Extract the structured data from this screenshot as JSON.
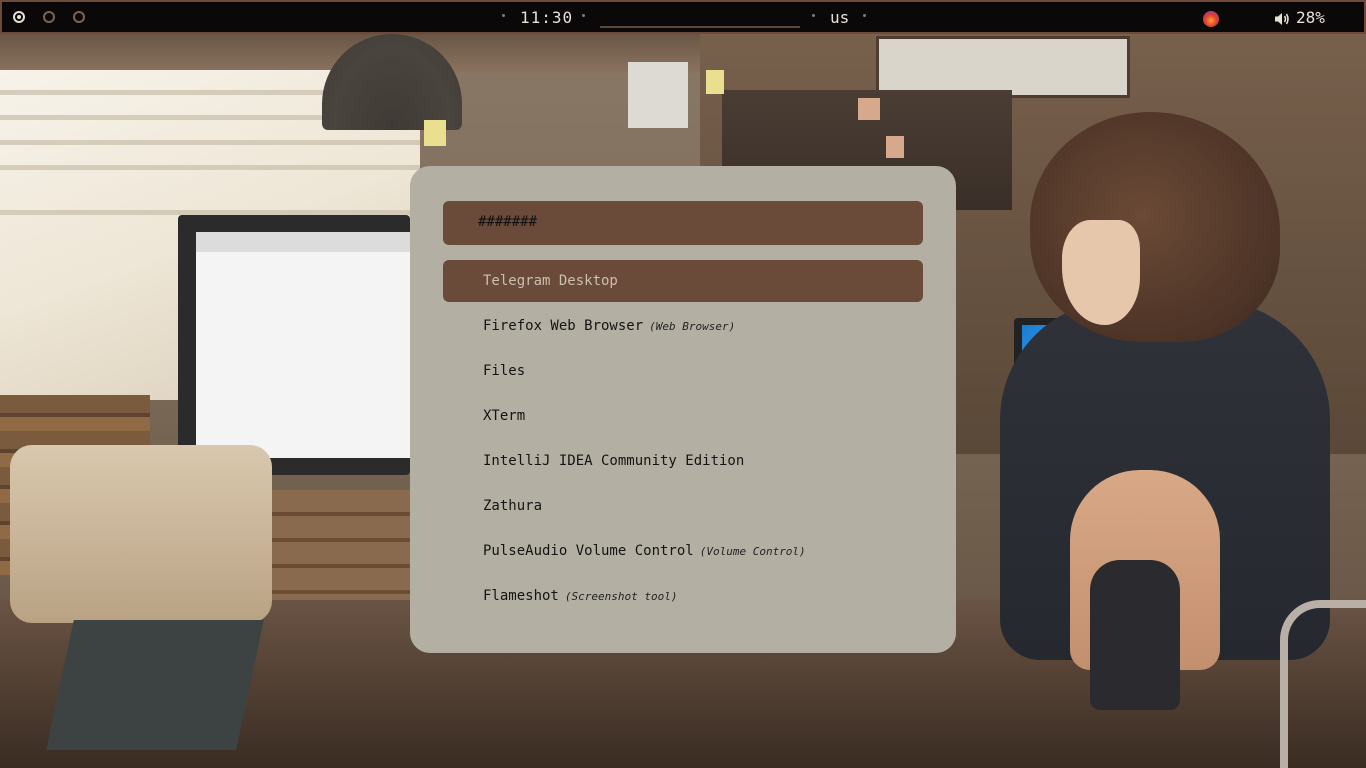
{
  "topbar": {
    "workspaces": [
      {
        "name": "workspace-1",
        "active": true
      },
      {
        "name": "workspace-2",
        "active": false
      },
      {
        "name": "workspace-3",
        "active": false
      }
    ],
    "clock": "11:30",
    "keyboard_layout": "us",
    "volume_label": "28%",
    "tray_icons": [
      "firefox-tray-icon",
      "speaker-icon"
    ]
  },
  "launcher": {
    "search_value": "#######",
    "selected_index": 0,
    "items": [
      {
        "name": "Telegram Desktop",
        "desc": ""
      },
      {
        "name": "Firefox Web Browser",
        "desc": "(Web Browser)"
      },
      {
        "name": "Files",
        "desc": ""
      },
      {
        "name": "XTerm",
        "desc": ""
      },
      {
        "name": "IntelliJ IDEA Community Edition",
        "desc": ""
      },
      {
        "name": "Zathura",
        "desc": ""
      },
      {
        "name": "PulseAudio Volume Control",
        "desc": "(Volume Control)"
      },
      {
        "name": "Flameshot",
        "desc": "(Screenshot tool)"
      }
    ]
  },
  "colors": {
    "bar_bg": "#0a0808",
    "bar_border": "#6d4a39",
    "launcher_bg": "#b3b0a3",
    "accent": "#6a4a38",
    "selected_text": "#cbbfb2"
  }
}
